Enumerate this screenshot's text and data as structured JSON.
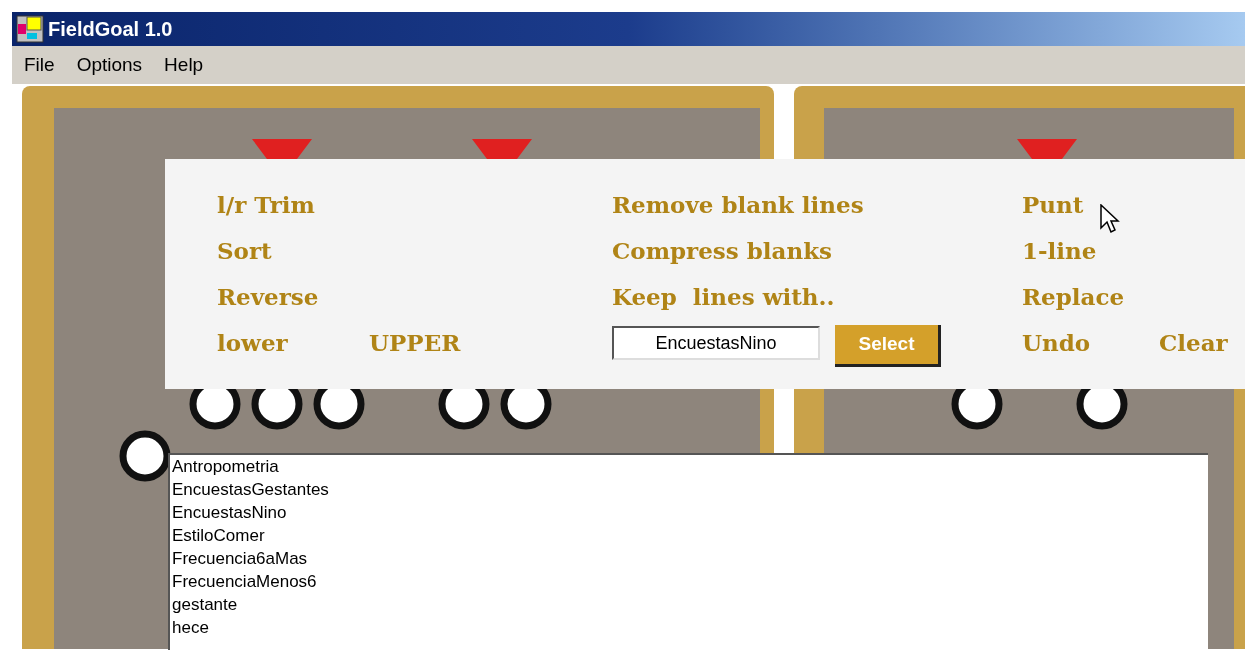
{
  "window": {
    "title": "FieldGoal 1.0"
  },
  "menu": [
    "File",
    "Options",
    "Help"
  ],
  "command_rows": [
    {
      "items": [
        {
          "kind": "command",
          "label": "l/r Trim"
        },
        {
          "kind": "command",
          "label": "Remove blank lines"
        },
        {
          "kind": "command",
          "label": "Punt"
        }
      ]
    },
    {
      "items": [
        {
          "kind": "command",
          "label": "Sort"
        },
        {
          "kind": "command",
          "label": "Compress blanks"
        },
        {
          "kind": "command",
          "label": "1-line"
        }
      ]
    },
    {
      "items": [
        {
          "kind": "command",
          "label": "Reverse"
        },
        {
          "kind": "command",
          "label": "Keep  lines with.."
        },
        {
          "kind": "command",
          "label": "Replace"
        }
      ]
    },
    {
      "items": [
        {
          "kind": "command",
          "label": "lower"
        },
        {
          "kind": "command",
          "label": "UPPER"
        },
        {
          "kind": "field",
          "value": "EncuestasNino"
        },
        {
          "kind": "button",
          "label": "Select"
        },
        {
          "kind": "command",
          "label": "Undo"
        },
        {
          "kind": "command",
          "label": "Clear"
        }
      ]
    }
  ],
  "list_items": [
    "Antropometria",
    "EncuestasGestantes",
    "EncuestasNino",
    "EstiloComer",
    "Frecuencia6aMas",
    "FrecuenciaMenos6",
    "gestante",
    "hece"
  ]
}
